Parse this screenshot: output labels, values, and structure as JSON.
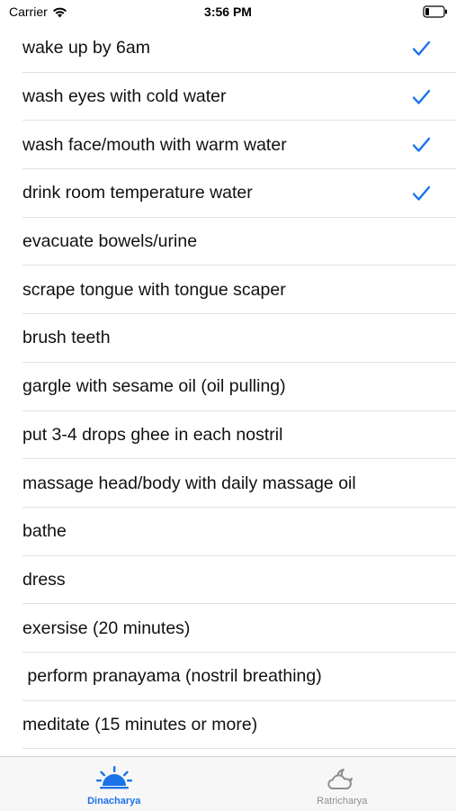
{
  "status_bar": {
    "carrier": "Carrier",
    "time": "3:56 PM",
    "icons": [
      "wifi-icon",
      "battery-icon"
    ]
  },
  "tasks": [
    {
      "label": "wake up by 6am",
      "checked": true
    },
    {
      "label": "wash eyes with cold water",
      "checked": true
    },
    {
      "label": "wash face/mouth with warm water",
      "checked": true
    },
    {
      "label": "drink room temperature water",
      "checked": true
    },
    {
      "label": "evacuate bowels/urine",
      "checked": false
    },
    {
      "label": "scrape tongue with tongue scaper",
      "checked": false
    },
    {
      "label": "brush teeth",
      "checked": false
    },
    {
      "label": "gargle with sesame oil (oil pulling)",
      "checked": false
    },
    {
      "label": "put 3-4 drops ghee in each nostril",
      "checked": false
    },
    {
      "label": "massage head/body with daily massage oil",
      "checked": false
    },
    {
      "label": "bathe",
      "checked": false
    },
    {
      "label": "dress",
      "checked": false
    },
    {
      "label": "exersise (20 minutes)",
      "checked": false
    },
    {
      "label": " perform pranayama (nostril breathing)",
      "checked": false
    },
    {
      "label": "meditate (15 minutes or more)",
      "checked": false
    }
  ],
  "tab_bar": {
    "tabs": [
      {
        "label": "Dinacharya",
        "icon": "sunrise-icon",
        "active": true
      },
      {
        "label": "Ratricharya",
        "icon": "cloud-moon-icon",
        "active": false
      }
    ]
  },
  "colors": {
    "accent": "#1a73e8",
    "inactive": "#8e8e93",
    "separator": "#e2e2e4",
    "tab_bar_bg": "#f7f7f7"
  }
}
